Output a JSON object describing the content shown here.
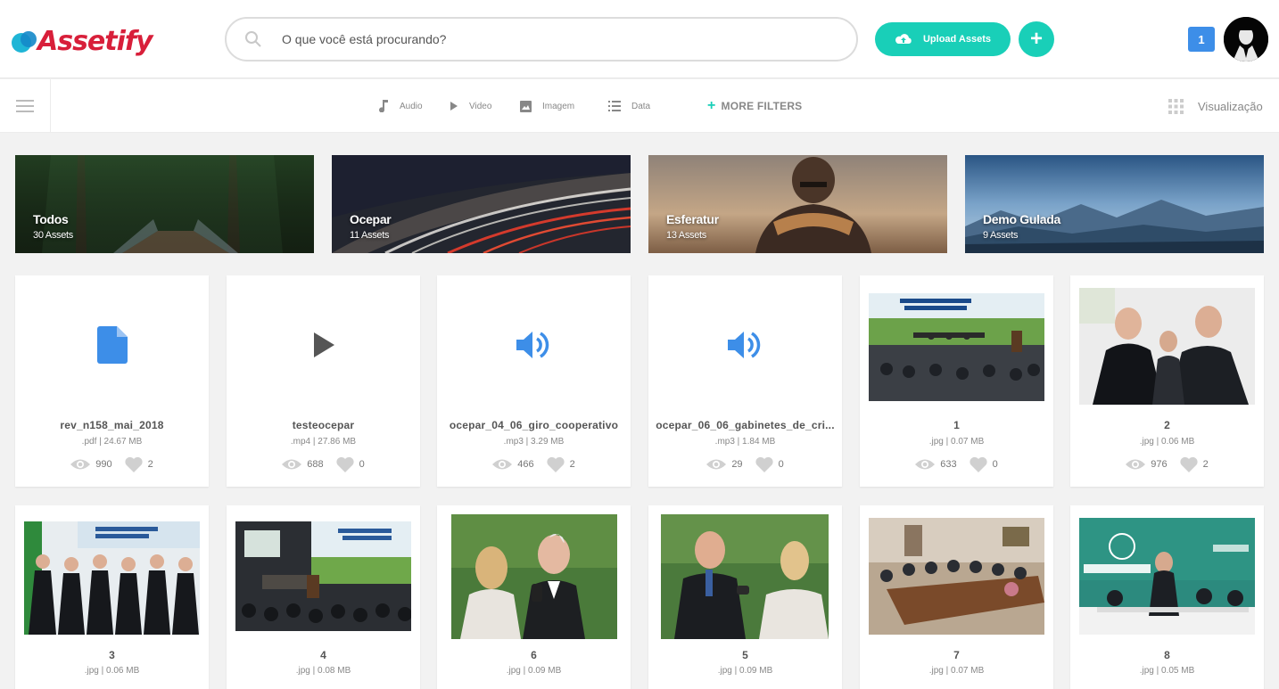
{
  "app": {
    "logo_text": "Assetify"
  },
  "search": {
    "placeholder": "O que você está procurando?"
  },
  "header": {
    "upload_label": "Upload Assets",
    "add_label": "+",
    "notification_count": "1"
  },
  "filters": {
    "items": [
      {
        "label": "Audio",
        "icon": "music-note-icon"
      },
      {
        "label": "Video",
        "icon": "play-icon"
      },
      {
        "label": "Imagem",
        "icon": "image-icon"
      },
      {
        "label": "Data",
        "icon": "list-icon"
      }
    ],
    "more_label": "MORE FILTERS",
    "view_label": "Visualização"
  },
  "collections": [
    {
      "title": "Todos",
      "count": "30 Assets"
    },
    {
      "title": "Ocepar",
      "count": "11 Assets"
    },
    {
      "title": "Esferatur",
      "count": "13 Assets"
    },
    {
      "title": "Demo Gulada",
      "count": "9 Assets"
    }
  ],
  "assets": [
    {
      "name": "rev_n158_mai_2018",
      "meta": ".pdf | 24.67 MB",
      "views": "990",
      "likes": "2",
      "kind": "document"
    },
    {
      "name": "testeocepar",
      "meta": ".mp4 | 27.86 MB",
      "views": "688",
      "likes": "0",
      "kind": "video"
    },
    {
      "name": "ocepar_04_06_giro_cooperativo",
      "meta": ".mp3 | 3.29 MB",
      "views": "466",
      "likes": "2",
      "kind": "audio"
    },
    {
      "name": "ocepar_06_06_gabinetes_de_cri...",
      "meta": ".mp3 | 1.84 MB",
      "views": "29",
      "likes": "0",
      "kind": "audio"
    },
    {
      "name": "1",
      "meta": ".jpg | 0.07 MB",
      "views": "633",
      "likes": "0",
      "kind": "image"
    },
    {
      "name": "2",
      "meta": ".jpg | 0.06 MB",
      "views": "976",
      "likes": "2",
      "kind": "image"
    },
    {
      "name": "3",
      "meta": ".jpg | 0.06 MB",
      "kind": "image"
    },
    {
      "name": "4",
      "meta": ".jpg | 0.08 MB",
      "kind": "image"
    },
    {
      "name": "6",
      "meta": ".jpg | 0.09 MB",
      "kind": "image"
    },
    {
      "name": "5",
      "meta": ".jpg | 0.09 MB",
      "kind": "image"
    },
    {
      "name": "7",
      "meta": ".jpg | 0.07 MB",
      "kind": "image"
    },
    {
      "name": "8",
      "meta": ".jpg | 0.05 MB",
      "kind": "image"
    }
  ],
  "colors": {
    "accent": "#19cfb8",
    "brand": "#d81f3a",
    "icon_blue": "#3d8ee8"
  }
}
